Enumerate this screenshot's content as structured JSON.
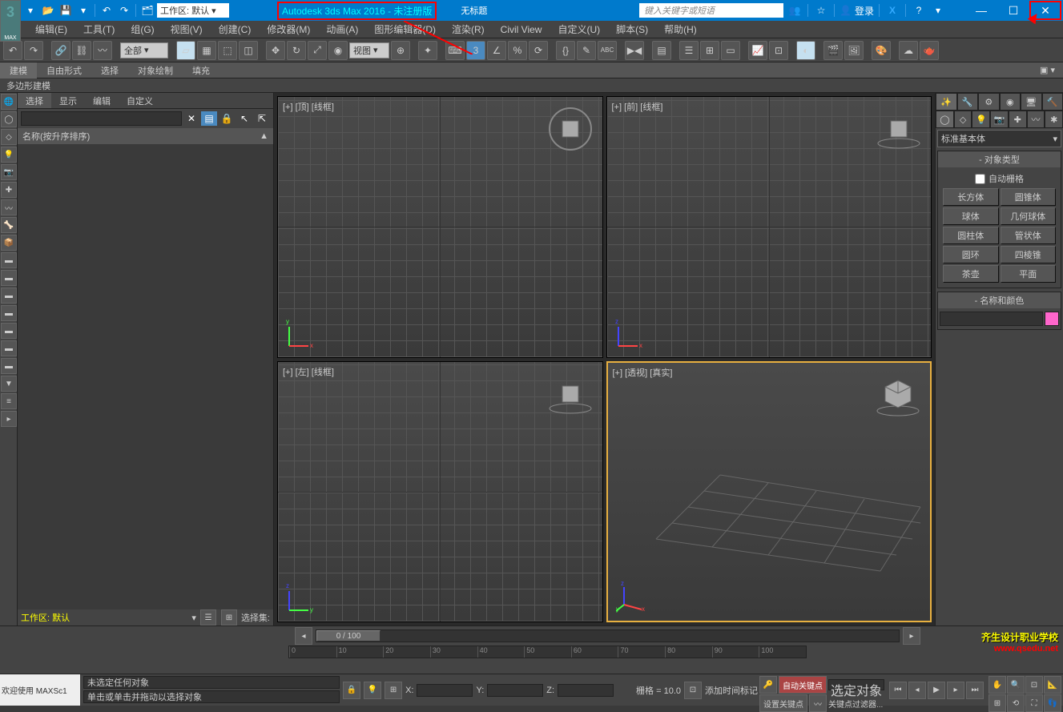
{
  "app_icon_label": "MAX",
  "titlebar": {
    "workspace_label": "工作区: 默认",
    "app_title": "Autodesk 3ds Max 2016 - 未注册版",
    "doc_title": "无标题",
    "search_placeholder": "键入关键字或短语",
    "login_label": "登录"
  },
  "menubar": [
    "编辑(E)",
    "工具(T)",
    "组(G)",
    "视图(V)",
    "创建(C)",
    "修改器(M)",
    "动画(A)",
    "图形编辑器(D)",
    "渲染(R)",
    "Civil View",
    "自定义(U)",
    "脚本(S)",
    "帮助(H)"
  ],
  "toolbar": {
    "filter_dd": "全部",
    "coord_dd": "视图"
  },
  "ribbon": {
    "tabs": [
      "建模",
      "自由形式",
      "选择",
      "对象绘制",
      "填充"
    ],
    "subtab": "多边形建模"
  },
  "scene_explorer": {
    "tabs": [
      "选择",
      "显示",
      "编辑",
      "自定义"
    ],
    "header": "名称(按升序排序)",
    "workspace": "工作区: 默认",
    "selset_label": "选择集:"
  },
  "viewports": {
    "top": "[+] [顶] [线框]",
    "front": "[+] [前] [线框]",
    "left": "[+] [左] [线框]",
    "persp": "[+] [透视] [真实]"
  },
  "cmd_panel": {
    "category_dd": "标准基本体",
    "rollout_objtype": "对象类型",
    "autogrid": "自动栅格",
    "objects": [
      "长方体",
      "圆锥体",
      "球体",
      "几何球体",
      "圆柱体",
      "管状体",
      "圆环",
      "四棱锥",
      "茶壶",
      "平面"
    ],
    "rollout_namecolor": "名称和颜色"
  },
  "timeline": {
    "slider_value": "0 / 100",
    "ticks": [
      "0",
      "10",
      "20",
      "30",
      "40",
      "50",
      "60",
      "70",
      "80",
      "90",
      "100"
    ]
  },
  "status": {
    "x_label": "X:",
    "y_label": "Y:",
    "z_label": "Z:",
    "grid_label": "栅格 = 10.0",
    "autokey": "自动关键点",
    "setkey": "设置关键点",
    "selobj": "选定对象",
    "keyfilter": "关键点过滤器...",
    "addtime": "添加时间标记",
    "no_selection": "未选定任何对象",
    "hint": "单击或单击并拖动以选择对象"
  },
  "script": {
    "welcome": "欢迎使用  MAXSc1"
  },
  "watermark": {
    "cn": "齐生设计职业学校",
    "url": "www.qsedu.net"
  }
}
